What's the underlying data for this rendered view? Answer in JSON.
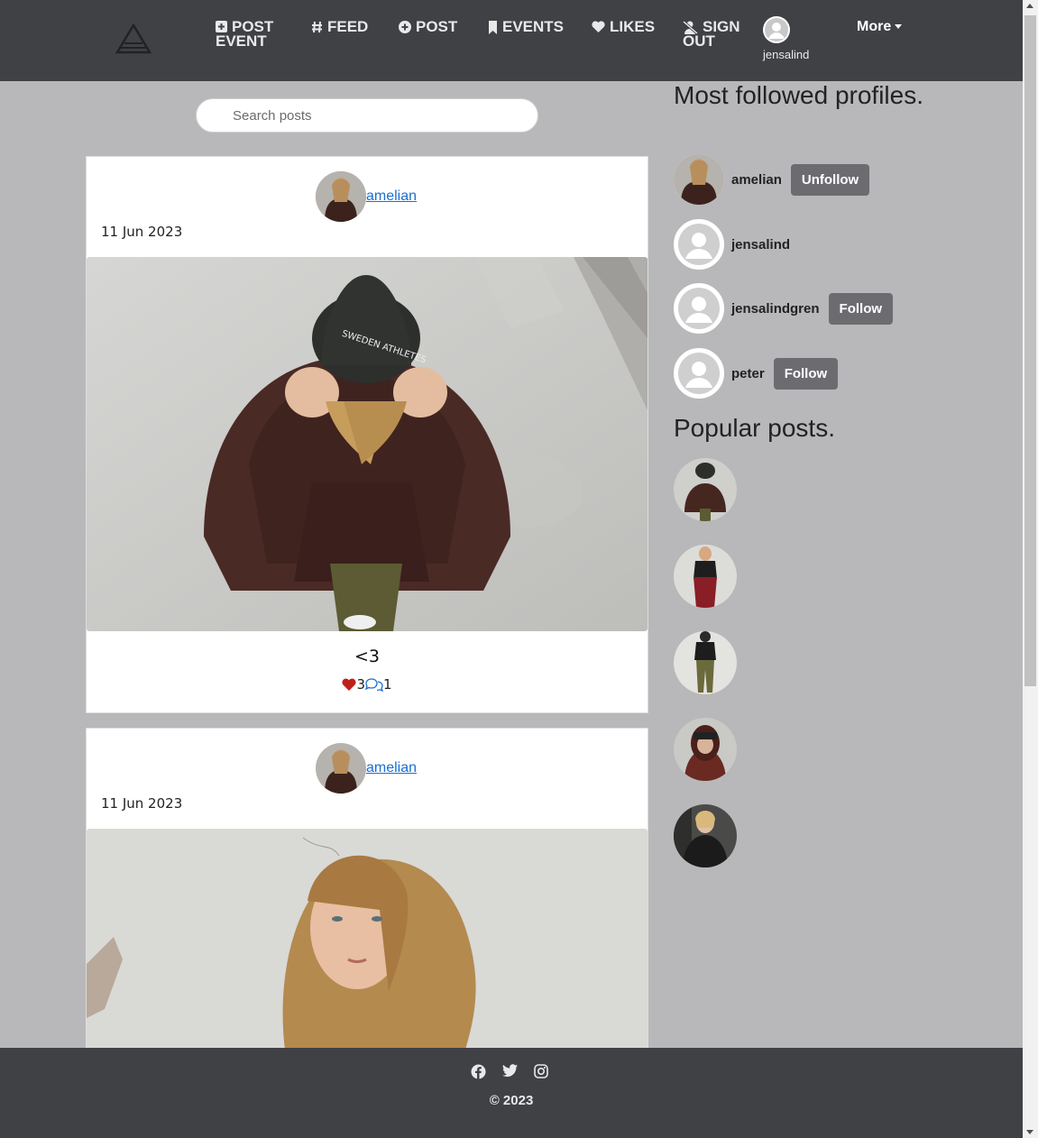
{
  "nav": {
    "items": [
      {
        "label": "POST",
        "label2": "EVENT",
        "icon": "plus-square-icon"
      },
      {
        "label": "FEED",
        "icon": "hash-icon"
      },
      {
        "label": "POST",
        "icon": "plus-circle-icon"
      },
      {
        "label": "EVENTS",
        "icon": "bookmark-icon"
      },
      {
        "label": "LIKES",
        "icon": "heart-icon"
      },
      {
        "label": "SIGN",
        "label2": "OUT",
        "icon": "user-slash-icon"
      }
    ],
    "username": "jensalind",
    "more_label": "More"
  },
  "search": {
    "placeholder": "Search posts"
  },
  "posts": [
    {
      "author": "amelian",
      "date": "11 Jun 2023",
      "caption": "<3",
      "likes": "3",
      "comments": "1"
    },
    {
      "author": "amelian",
      "date": "11 Jun 2023"
    }
  ],
  "sidebar": {
    "profiles_title": "Most followed profiles.",
    "profiles": [
      {
        "name": "amelian",
        "button": "Unfollow"
      },
      {
        "name": "jensalind"
      },
      {
        "name": "jensalindgren",
        "button": "Follow"
      },
      {
        "name": "peter",
        "button": "Follow"
      }
    ],
    "popular_title": "Popular posts."
  },
  "footer": {
    "copyright": "© 2023",
    "icons": [
      "facebook-icon",
      "twitter-icon",
      "instagram-icon"
    ]
  },
  "colors": {
    "navbar": "#3f4145",
    "background": "#b8b8ba",
    "button": "#6c6c70",
    "link": "#1a6fd3",
    "heart": "#c0201a"
  }
}
